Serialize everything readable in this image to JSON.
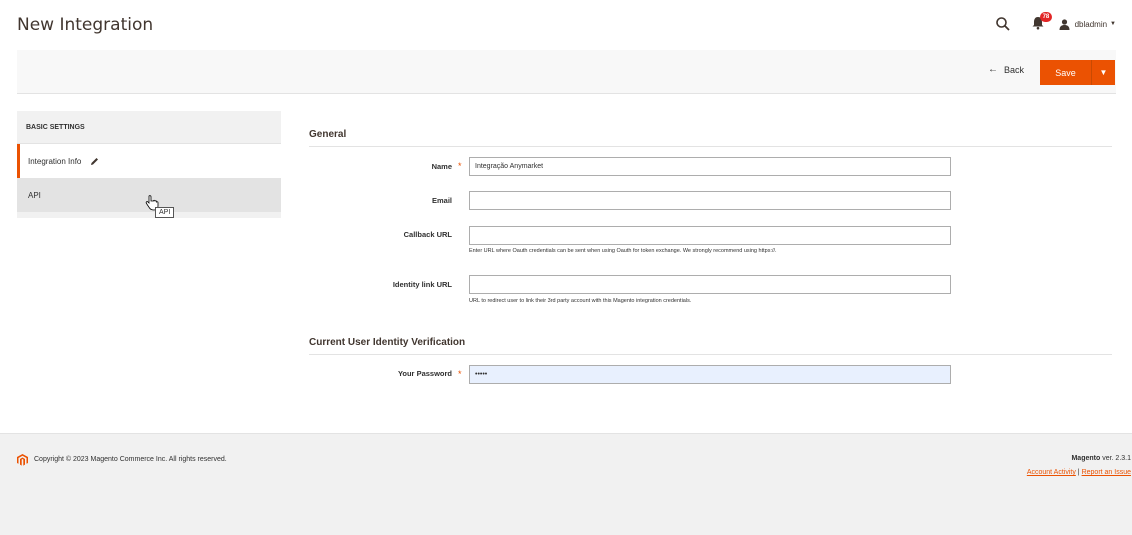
{
  "page": {
    "title": "New Integration"
  },
  "header": {
    "notification_count": "78",
    "username": "dbladmin"
  },
  "toolbar": {
    "back_label": "Back",
    "save_label": "Save"
  },
  "sidebar": {
    "title": "BASIC SETTINGS",
    "items": [
      {
        "label": "Integration Info"
      },
      {
        "label": "API"
      }
    ],
    "tooltip": "API"
  },
  "sections": {
    "general_title": "General",
    "verification_title": "Current User Identity Verification"
  },
  "form": {
    "name_label": "Name",
    "name_value": "Integração Anymarket",
    "email_label": "Email",
    "email_value": "",
    "callback_label": "Callback URL",
    "callback_value": "",
    "callback_note": "Enter URL where Oauth credentials can be sent when using Oauth for token exchange. We strongly recommend using https://.",
    "identity_label": "Identity link URL",
    "identity_value": "",
    "identity_note": "URL to redirect user to link their 3rd party account with this Magento integration credentials.",
    "password_label": "Your Password",
    "password_value": "•••••"
  },
  "footer": {
    "copyright": "Copyright © 2023 Magento Commerce Inc. All rights reserved.",
    "brand": "Magento",
    "version": "ver. 2.3.1",
    "account_activity": "Account Activity",
    "separator": "|",
    "report_issue": "Report an Issue"
  },
  "colors": {
    "accent": "#eb5202",
    "badge": "#e22626"
  }
}
